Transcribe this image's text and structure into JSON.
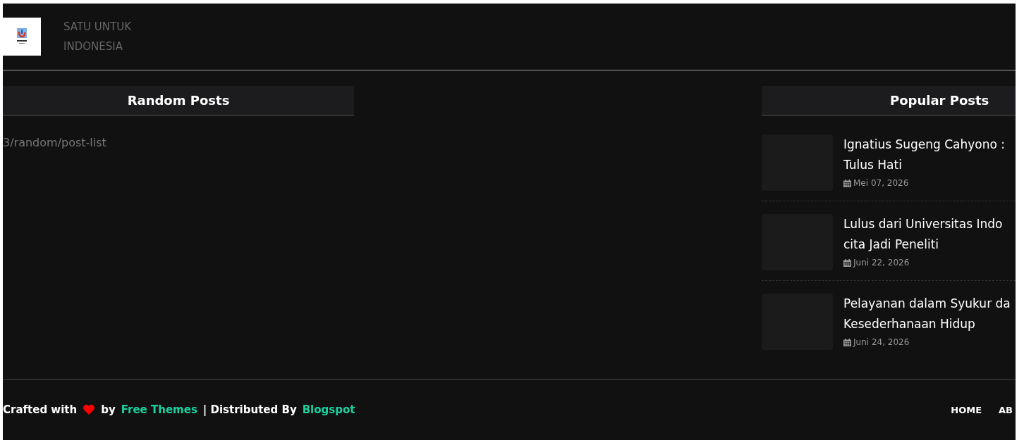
{
  "header": {
    "tagline_lines": [
      "SATU UNTUK",
      "INDONESIA"
    ]
  },
  "random_posts": {
    "title": "Random Posts",
    "content": "3/random/post-list"
  },
  "popular_posts": {
    "title": "Popular Posts",
    "items": [
      {
        "title_lines": [
          "Ignatius Sugeng Cahyono :",
          "Tulus Hati"
        ],
        "date": "Mei 07, 2026"
      },
      {
        "title_lines": [
          "Lulus dari Universitas Indo",
          "cita Jadi Peneliti"
        ],
        "date": "Juni 22, 2026"
      },
      {
        "title_lines": [
          "Pelayanan dalam Syukur da",
          "Kesederhanaan Hidup"
        ],
        "date": "Juni 24, 2026"
      }
    ]
  },
  "footer": {
    "parts": [
      {
        "kind": "text",
        "text": "Crafted with"
      },
      {
        "kind": "heart"
      },
      {
        "kind": "text",
        "text": "by"
      },
      {
        "kind": "link",
        "text": "Free Themes"
      },
      {
        "kind": "text",
        "text": "| Distributed By"
      },
      {
        "kind": "link",
        "text": "Blogspot"
      }
    ],
    "menu": [
      "HOME",
      "AB"
    ]
  }
}
